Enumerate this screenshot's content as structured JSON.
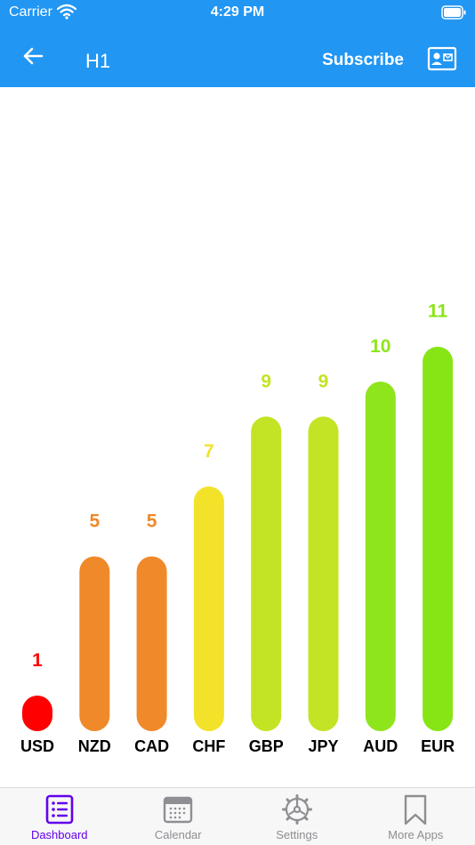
{
  "status_bar": {
    "carrier": "Carrier",
    "time": "4:29 PM"
  },
  "header": {
    "title": "H1",
    "subscribe_label": "Subscribe"
  },
  "tabs": [
    {
      "label": "Dashboard",
      "icon": "list-icon",
      "active": true
    },
    {
      "label": "Calendar",
      "icon": "calendar-icon",
      "active": false
    },
    {
      "label": "Settings",
      "icon": "gear-icon",
      "active": false
    },
    {
      "label": "More Apps",
      "icon": "bookmark-icon",
      "active": false
    }
  ],
  "colors": {
    "primary": "#2196f3",
    "active_tab": "#6200ee"
  },
  "chart_data": {
    "type": "bar",
    "categories": [
      "USD",
      "NZD",
      "CAD",
      "CHF",
      "GBP",
      "JPY",
      "AUD",
      "EUR"
    ],
    "values": [
      1,
      5,
      5,
      7,
      9,
      9,
      10,
      11
    ],
    "colors": [
      "#ff0000",
      "#f0892a",
      "#f0892a",
      "#f3e22a",
      "#c3e425",
      "#c3e425",
      "#8fe51c",
      "#88e515"
    ],
    "ylim": [
      0,
      11
    ],
    "grid": false,
    "data_labels": true
  }
}
